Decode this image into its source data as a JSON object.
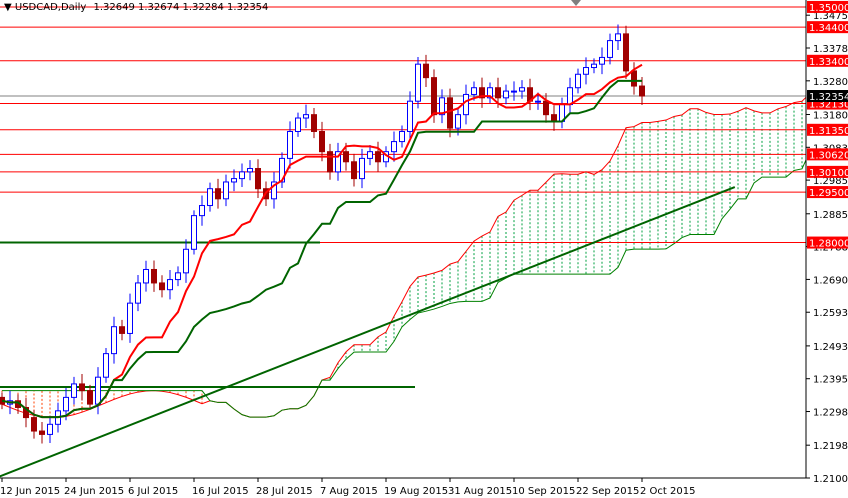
{
  "header": {
    "symbol": "USDCAD,Daily",
    "ohlc": "1.32649 1.32674 1.32284 1.32354"
  },
  "colors": {
    "bull": "#0000ff",
    "bear": "#a00000",
    "tenkan": "#ff0000",
    "kijun": "#006400",
    "level": "#ff0000",
    "trend": "#006400"
  },
  "chart_data": {
    "type": "candlestick",
    "title": "USDCAD,Daily",
    "ylim": [
      1.2085,
      1.352
    ],
    "y_ticks": [
      "1.34755",
      "1.33780",
      "1.32805",
      "1.31805",
      "1.30830",
      "1.29855",
      "1.28855",
      "1.27880",
      "1.26905",
      "1.25930",
      "1.24930",
      "1.23955",
      "1.22980",
      "1.21980",
      "1.21005"
    ],
    "x_labels": [
      {
        "i": 0,
        "label": "12 Jun 2015"
      },
      {
        "i": 8,
        "label": "24 Jun 2015"
      },
      {
        "i": 16,
        "label": "6 Jul 2015"
      },
      {
        "i": 24,
        "label": "16 Jul 2015"
      },
      {
        "i": 32,
        "label": "28 Jul 2015"
      },
      {
        "i": 40,
        "label": "7 Aug 2015"
      },
      {
        "i": 48,
        "label": "19 Aug 2015"
      },
      {
        "i": 56,
        "label": "31 Aug 2015"
      },
      {
        "i": 64,
        "label": "10 Sep 2015"
      },
      {
        "i": 72,
        "label": "22 Sep 2015"
      },
      {
        "i": 80,
        "label": "2 Oct 2015"
      }
    ],
    "closes": [
      1.232,
      1.233,
      1.231,
      1.228,
      1.224,
      1.223,
      1.226,
      1.23,
      1.234,
      1.238,
      1.236,
      1.232,
      1.24,
      1.247,
      1.255,
      1.253,
      1.262,
      1.268,
      1.272,
      1.268,
      1.266,
      1.269,
      1.271,
      1.278,
      1.288,
      1.291,
      1.296,
      1.293,
      1.298,
      1.299,
      1.301,
      1.302,
      1.296,
      1.293,
      1.298,
      1.305,
      1.313,
      1.317,
      1.318,
      1.313,
      1.307,
      1.301,
      1.307,
      1.304,
      1.299,
      1.305,
      1.307,
      1.304,
      1.307,
      1.31,
      1.313,
      1.322,
      1.333,
      1.329,
      1.318,
      1.323,
      1.314,
      1.318,
      1.324,
      1.326,
      1.323,
      1.326,
      1.323,
      1.325,
      1.325,
      1.326,
      1.322,
      1.322,
      1.318,
      1.316,
      1.321,
      1.326,
      1.33,
      1.332,
      1.333,
      1.335,
      1.34,
      1.342,
      1.331,
      1.3265,
      1.32354
    ],
    "levels": [
      {
        "price": 1.35,
        "label": "1.35000"
      },
      {
        "price": 1.344,
        "label": "1.34400"
      },
      {
        "price": 1.334,
        "label": "1.33400"
      },
      {
        "price": 1.3213,
        "label": "1.32130"
      },
      {
        "price": 1.3135,
        "label": "1.31350"
      },
      {
        "price": 1.3062,
        "label": "1.30620"
      },
      {
        "price": 1.301,
        "label": "1.30100"
      },
      {
        "price": 1.295,
        "label": "1.29500"
      },
      {
        "price": 1.28,
        "label": "1.28000"
      }
    ],
    "current_price": {
      "price": 1.32354,
      "label": "1.32354"
    },
    "support_line": 1.2371,
    "trendline": {
      "from": {
        "i": -0.3,
        "price": 1.2105
      },
      "to": {
        "i": 91.6,
        "price": 1.2965
      }
    }
  }
}
